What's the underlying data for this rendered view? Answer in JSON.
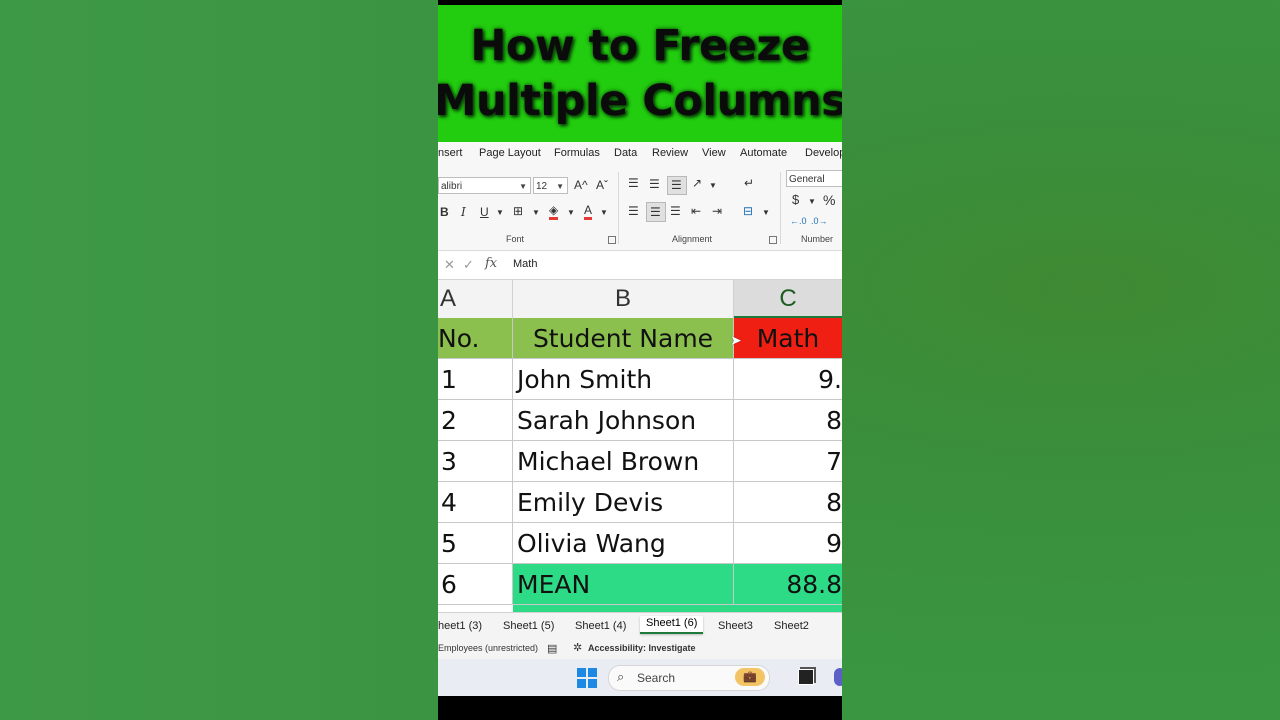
{
  "title": {
    "line1": "How to Freeze",
    "line2": "Multiple Columns"
  },
  "ribbon": {
    "tabs": [
      "nsert",
      "Page Layout",
      "Formulas",
      "Data",
      "Review",
      "View",
      "Automate",
      "Develop"
    ],
    "font_name": "alibri",
    "font_size": "12",
    "grow_font": "A^",
    "shrink_font": "Aˇ",
    "bold": "B",
    "italic": "I",
    "underline": "U",
    "groups": {
      "font": "Font",
      "alignment": "Alignment",
      "number": "Number"
    },
    "number_format": "General",
    "currency": "$",
    "percent": "%"
  },
  "formula_bar": {
    "fx": "fx",
    "value": "Math"
  },
  "columns": {
    "a": "A",
    "b": "B",
    "c": "C"
  },
  "table": {
    "header": {
      "a": "No.",
      "b": "Student Name",
      "c": "Math"
    },
    "rows": [
      {
        "a": "1",
        "b": "John Smith",
        "c": "9."
      },
      {
        "a": "2",
        "b": "Sarah Johnson",
        "c": "8"
      },
      {
        "a": "3",
        "b": "Michael Brown",
        "c": "7"
      },
      {
        "a": "4",
        "b": "Emily Devis",
        "c": "8"
      },
      {
        "a": "5",
        "b": "Olivia Wang",
        "c": "9"
      },
      {
        "a": "6",
        "b": "MEAN",
        "c": "88.8"
      }
    ]
  },
  "sheets": [
    "heet1 (3)",
    "Sheet1 (5)",
    "Sheet1 (4)",
    "Sheet1 (6)",
    "Sheet3",
    "Sheet2"
  ],
  "active_sheet": "Sheet1 (6)",
  "status": {
    "sensitivity": "Employees (unrestricted)",
    "accessibility": "Accessibility: Investigate"
  },
  "taskbar": {
    "search_placeholder": "Search"
  },
  "colors": {
    "banner": "#22cc0f",
    "header_green": "#8cc04e",
    "header_red": "#f01f14",
    "mean_green": "#2ddb87",
    "background": "#3a9540"
  }
}
